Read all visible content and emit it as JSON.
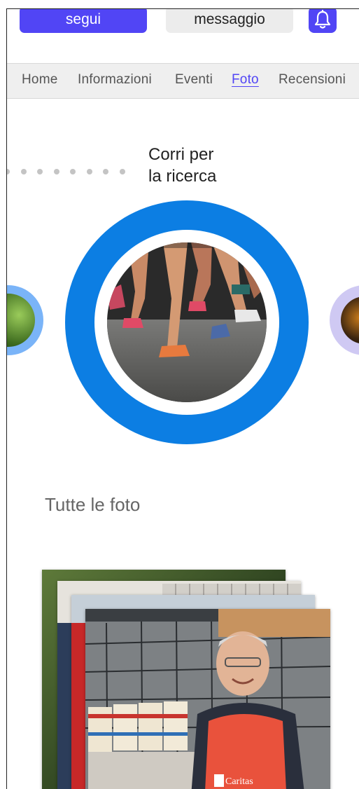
{
  "actions": {
    "follow_label": "segui",
    "message_label": "messaggio",
    "bell_icon": "bell-icon",
    "accent_color": "#5145f5"
  },
  "tabs": [
    {
      "label": "Home",
      "active": false
    },
    {
      "label": "Informazioni",
      "active": false
    },
    {
      "label": "Eventi",
      "active": false
    },
    {
      "label": "Foto",
      "active": true
    },
    {
      "label": "Recensioni",
      "active": false
    }
  ],
  "carousel": {
    "current_title_line1": "Corri per",
    "current_title_line2": "la ricerca",
    "ring_color": "#0c7ee3",
    "left_ring_color": "#7ab4f8",
    "right_ring_color": "#cfc9f3",
    "pagination_dots": 8
  },
  "gallery": {
    "section_title": "Tutte le foto",
    "apron_text": "Caritas"
  }
}
